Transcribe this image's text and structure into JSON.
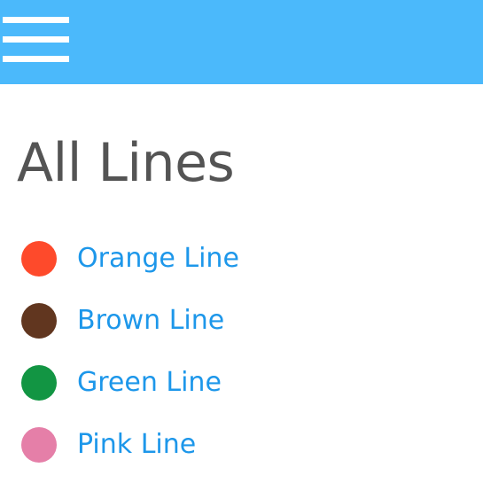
{
  "header": {
    "background_color": "#4bb9fb",
    "menu_icon": "hamburger-menu-icon"
  },
  "page": {
    "title": "All Lines"
  },
  "lines": [
    {
      "label": "Orange Line",
      "color": "#fe4a2b"
    },
    {
      "label": "Brown Line",
      "color": "#61361f"
    },
    {
      "label": "Green Line",
      "color": "#129543"
    },
    {
      "label": "Pink Line",
      "color": "#e57fa8"
    }
  ],
  "colors": {
    "link": "#1d97ea",
    "title": "#545454"
  }
}
